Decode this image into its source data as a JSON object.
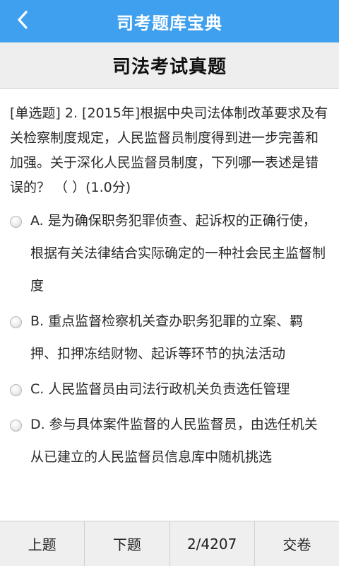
{
  "app": {
    "title": "司考题库宝典",
    "accent_color": "#3fa0ef",
    "back_icon": "chevron-left-icon"
  },
  "section": {
    "title": "司法考试真题"
  },
  "question": {
    "text": "[单选题] 2. [2015年]根据中央司法体制改革要求及有关检察制度规定，人民监督员制度得到进一步完善和加强。关于深化人民监督员制度，下列哪一表述是错误的？ （    ）(1.0分)",
    "options": [
      {
        "text": "A. 是为确保职务犯罪侦查、起诉权的正确行使，根据有关法律结合实际确定的一种社会民主监督制度"
      },
      {
        "text": "B. 重点监督检察机关查办职务犯罪的立案、羁押、扣押冻结财物、起诉等环节的执法活动"
      },
      {
        "text": "C. 人民监督员由司法行政机关负责选任管理"
      },
      {
        "text": "D. 参与具体案件监督的人民监督员，由选任机关从已建立的人民监督员信息库中随机挑选"
      }
    ]
  },
  "bottom_bar": {
    "prev_label": "上题",
    "next_label": "下题",
    "counter": "2/4207",
    "submit_label": "交卷"
  }
}
